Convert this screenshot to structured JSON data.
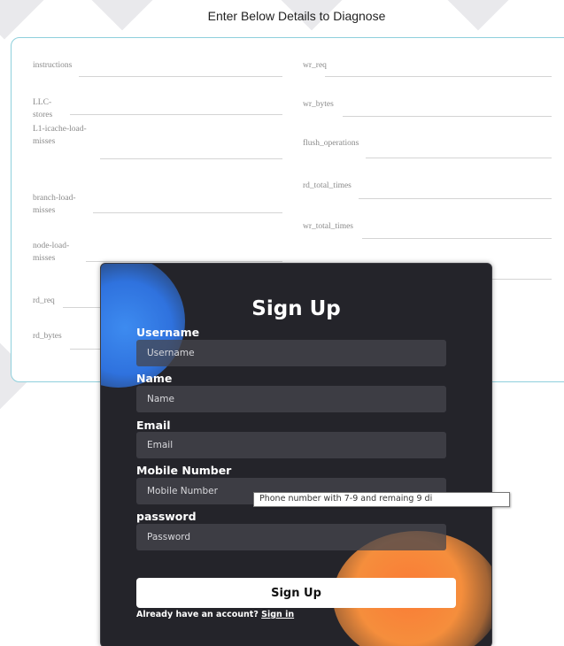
{
  "page": {
    "title": "Enter Below Details to Diagnose"
  },
  "diagnose_form": {
    "left_fields": [
      {
        "label": "instructions"
      },
      {
        "label": "LLC-\nstores"
      },
      {
        "label": "L1-icache-load-\nmisses"
      },
      {
        "label": "branch-load-\nmisses"
      },
      {
        "label": "node-load-\nmisses"
      },
      {
        "label": "rd_req"
      },
      {
        "label": "rd_bytes"
      }
    ],
    "right_fields": [
      {
        "label": "wr_req"
      },
      {
        "label": "wr_bytes"
      },
      {
        "label": "flush_operations"
      },
      {
        "label": "rd_total_times"
      },
      {
        "label": "wr_total_times"
      }
    ]
  },
  "signup": {
    "title": "Sign Up",
    "fields": [
      {
        "label": "Username",
        "placeholder": "Username",
        "value": ""
      },
      {
        "label": "Name",
        "placeholder": "Name",
        "value": ""
      },
      {
        "label": "Email",
        "placeholder": "Email",
        "value": ""
      },
      {
        "label": "Mobile Number",
        "placeholder": "Mobile Number",
        "value": ""
      },
      {
        "label": "password",
        "placeholder": "Password",
        "value": ""
      }
    ],
    "tooltip": "Phone number with 7-9 and remaing 9 di",
    "submit_label": "Sign Up",
    "footer_text": "Already have an account?",
    "signin_link": "Sign in"
  },
  "colors": {
    "card_border": "#8fd0dc",
    "signup_bg": "#24242a",
    "blob_blue": "#3d8bf0",
    "blob_orange": "#fb7b36"
  }
}
